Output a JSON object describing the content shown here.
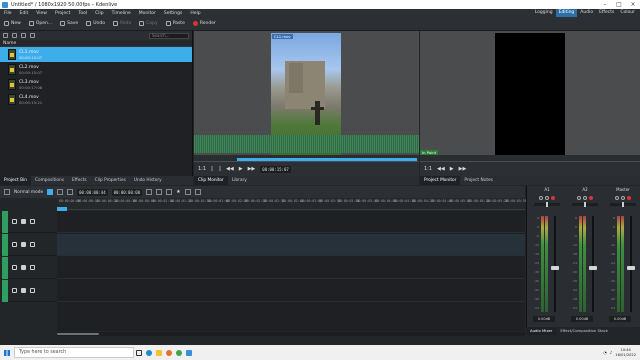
{
  "window": {
    "title": "Untitled* / 1080x1920 50.00fps – Kdenlive"
  },
  "menu": [
    "File",
    "Edit",
    "View",
    "Project",
    "Tool",
    "Clip",
    "Timeline",
    "Monitor",
    "Settings",
    "Help"
  ],
  "workspaces": {
    "items": [
      "Logging",
      "Editing",
      "Audio",
      "Effects",
      "Colour"
    ],
    "active": "Editing"
  },
  "toolbar": {
    "new": "New",
    "open": "Open...",
    "save": "Save",
    "undo": "Undo",
    "redo": "Redo",
    "copy": "Copy",
    "paste": "Paste",
    "render": "Render"
  },
  "bin": {
    "search_placeholder": "Search...",
    "header": "Name",
    "clips": [
      {
        "name": "CL1.mov",
        "duration": "00:00:15:07",
        "selected": true
      },
      {
        "name": "CL2.mov",
        "duration": "00:00:15:07",
        "selected": false
      },
      {
        "name": "CL3.mov",
        "duration": "00:00:17:08",
        "selected": false
      },
      {
        "name": "CL4.mov",
        "duration": "00:00:15:21",
        "selected": false
      }
    ],
    "tabs": [
      "Project Bin",
      "Compositions",
      "Effects",
      "Clip Properties",
      "Undo History"
    ]
  },
  "clip_monitor": {
    "clip_label": "CL1.mov",
    "zoom": "1:1",
    "timecode": "00:00:15:07",
    "tabs": [
      "Clip Monitor",
      "Library"
    ]
  },
  "project_monitor": {
    "zoom": "1:1",
    "tag": "In Point",
    "tabs": [
      "Project Monitor",
      "Project Notes"
    ]
  },
  "timeline": {
    "mode": "Normal mode",
    "position": "00:00:00:44",
    "duration": "00:00:00:00",
    "ruler": [
      "00:00:00:00",
      "00:00:00:12",
      "00:00:00:24",
      "00:00:00:36",
      "00:00:00:48",
      "00:00:01:10",
      "00:00:01:22",
      "00:00:01:34",
      "00:00:01:46",
      "00:00:02:08",
      "00:00:02:20",
      "00:00:02:32",
      "00:00:02:44",
      "00:00:03:06",
      "00:00:03:18",
      "00:00:03:30",
      "00:00:03:42",
      "00:00:04:04",
      "00:00:04:16",
      "00:00:04:28",
      "00:00:04:40",
      "00:00:05:02",
      "00:00:05:14",
      "00:00:05:26",
      "00:00:05:38"
    ]
  },
  "mixer": {
    "strips": [
      {
        "name": "A1",
        "db": "0.00dB",
        "level": 0.48
      },
      {
        "name": "A2",
        "db": "0.00dB",
        "level": 0.48
      },
      {
        "name": "Master",
        "db": "0.00dB",
        "level": 0.48
      }
    ],
    "scale": [
      "6",
      "0",
      "-6",
      "-12",
      "-18",
      "-24",
      "-30",
      "-36",
      "-42",
      "-48",
      "-54"
    ],
    "tabs": [
      "Audio Mixer",
      "Effect/Composition Stack"
    ]
  },
  "taskbar": {
    "search_placeholder": "Type here to search",
    "clock_time": "10:44",
    "clock_date": "16/01/2022"
  },
  "colors": {
    "accent": "#3daee9",
    "record": "#d93434",
    "track_tag": "#2e9f5f"
  }
}
